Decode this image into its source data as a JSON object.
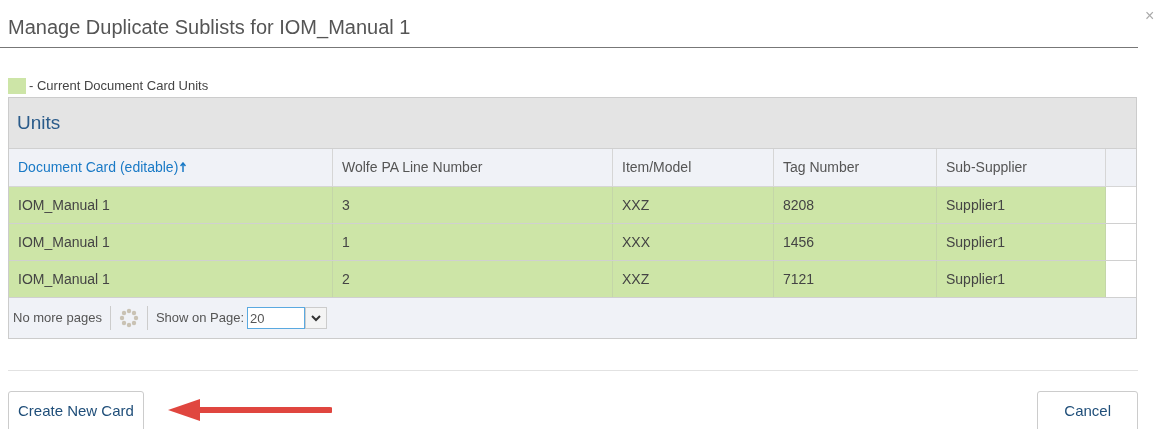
{
  "dialog": {
    "title": "Manage Duplicate Sublists for IOM_Manual 1",
    "close": "×"
  },
  "legend": {
    "color": "#cde5a7",
    "label": "- Current Document Card Units"
  },
  "table": {
    "title": "Units",
    "columns": [
      {
        "label": "Document Card (editable)",
        "sorted": true
      },
      {
        "label": "Wolfe PA Line Number",
        "sorted": false
      },
      {
        "label": "Item/Model",
        "sorted": false
      },
      {
        "label": "Tag Number",
        "sorted": false
      },
      {
        "label": "Sub-Supplier",
        "sorted": false
      }
    ],
    "rows": [
      {
        "current": true,
        "cells": [
          "IOM_Manual 1",
          "3",
          "XXZ",
          "8208",
          "Supplier1"
        ]
      },
      {
        "current": true,
        "cells": [
          "IOM_Manual 1",
          "1",
          "XXX",
          "1456",
          "Supplier1"
        ]
      },
      {
        "current": true,
        "cells": [
          "IOM_Manual 1",
          "2",
          "XXZ",
          "7121",
          "Supplier1"
        ]
      }
    ],
    "pager": {
      "status": "No more pages",
      "show_label": "Show on Page:",
      "page_size": "20"
    }
  },
  "buttons": [
    {
      "kind": "primary",
      "label": "Create New Card"
    },
    {
      "kind": "cancel",
      "label": "Cancel"
    }
  ]
}
